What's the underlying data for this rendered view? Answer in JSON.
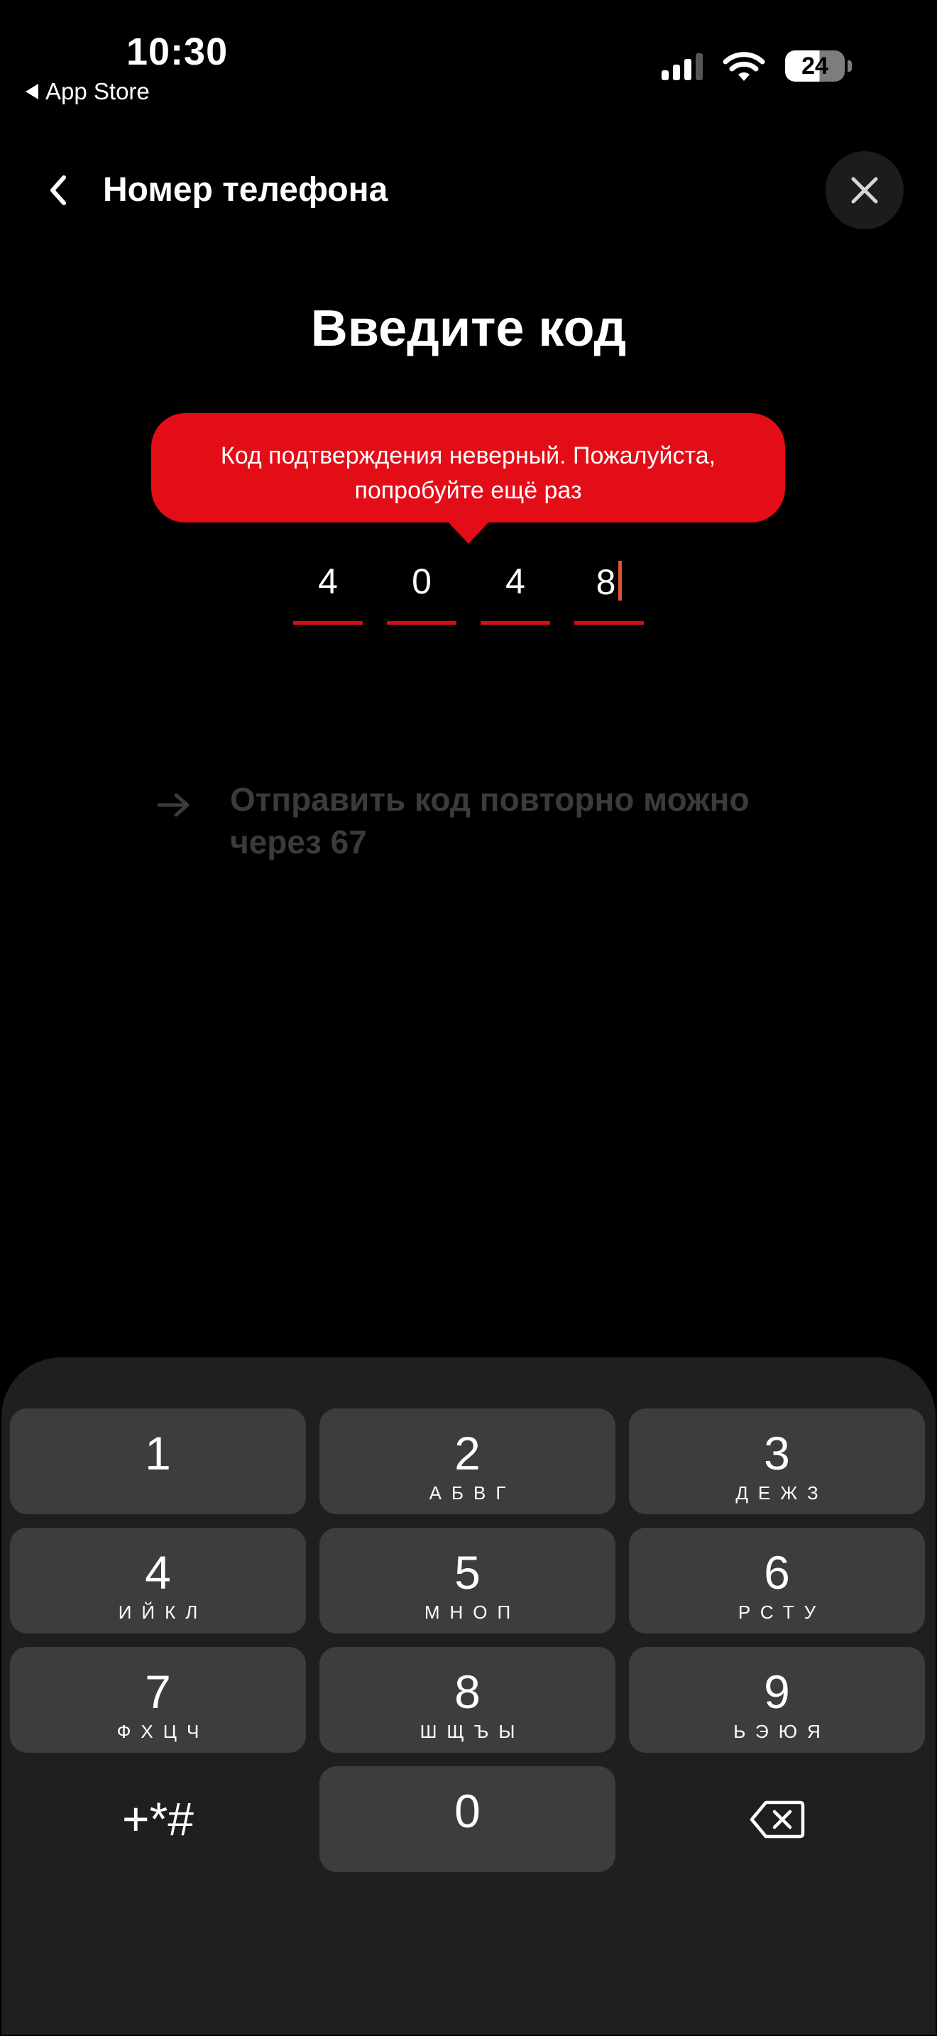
{
  "status_bar": {
    "time": "10:30",
    "back_app": "App Store",
    "battery": "24"
  },
  "header": {
    "title": "Номер телефона"
  },
  "main": {
    "heading": "Введите код",
    "error_line1": "Код подтверждения неверный. Пожалуйста,",
    "error_line2": "попробуйте ещё раз",
    "code_digits": [
      "4",
      "0",
      "4",
      "8"
    ],
    "resend_line1": "Отправить код повторно можно",
    "resend_line2": "через 67"
  },
  "keypad": {
    "keys": [
      {
        "num": "1",
        "letters": ""
      },
      {
        "num": "2",
        "letters": "АБВГ"
      },
      {
        "num": "3",
        "letters": "ДЕЖЗ"
      },
      {
        "num": "4",
        "letters": "ИЙКЛ"
      },
      {
        "num": "5",
        "letters": "МНОП"
      },
      {
        "num": "6",
        "letters": "РСТУ"
      },
      {
        "num": "7",
        "letters": "ФХЦЧ"
      },
      {
        "num": "8",
        "letters": "ШЩЪЫ"
      },
      {
        "num": "9",
        "letters": "ЬЭЮЯ"
      },
      {
        "num": "0",
        "letters": ""
      }
    ],
    "symbols": "+*#"
  },
  "colors": {
    "accent_red": "#e30d18",
    "underline_red": "#d40f16",
    "background": "#000000",
    "keypad_bg": "#1f1f21",
    "key_bg": "#3d3d3f",
    "disabled_text": "#3b3b3d"
  },
  "icons": {
    "back": "chevron-left-icon",
    "close": "close-icon",
    "resend": "arrow-right-icon",
    "delete": "backspace-icon"
  }
}
